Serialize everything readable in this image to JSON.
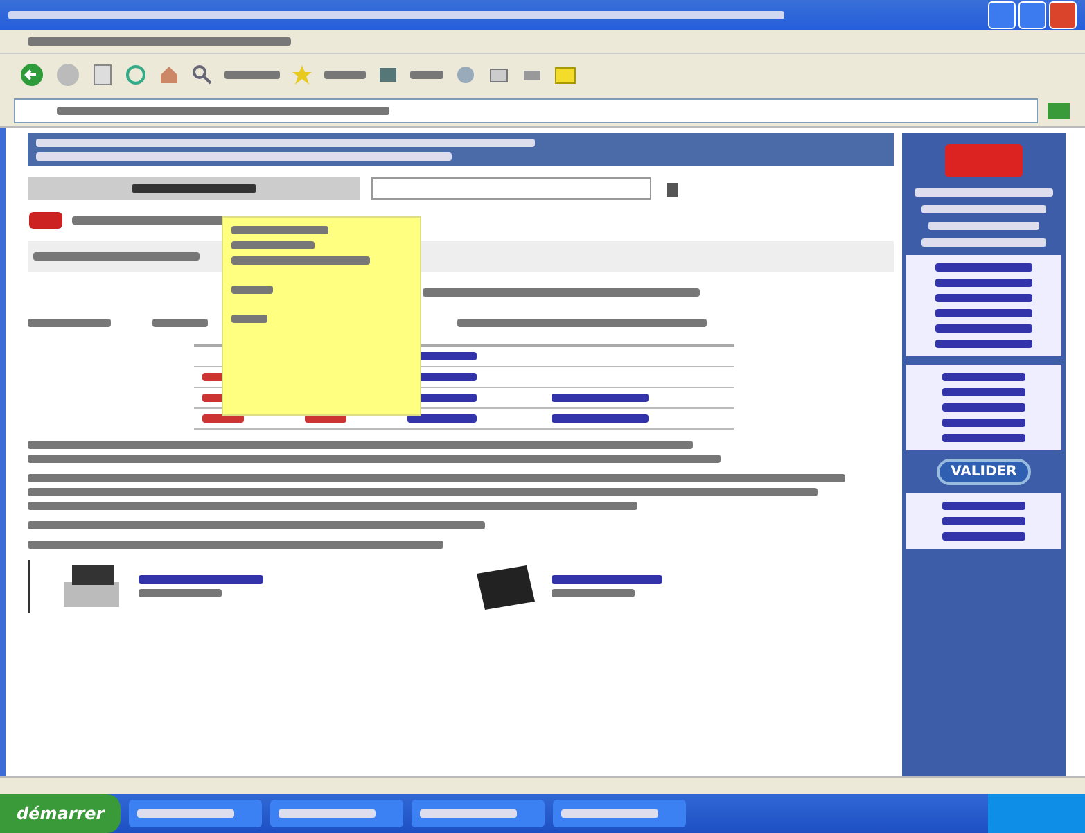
{
  "sidebar": {
    "submit_button": "VALIDER"
  },
  "taskbar": {
    "start_button": "démarrer"
  }
}
